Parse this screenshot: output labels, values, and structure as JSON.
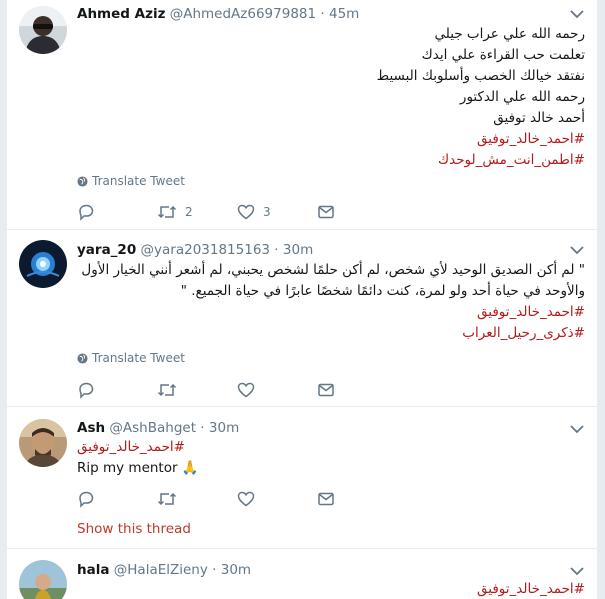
{
  "tweets": [
    {
      "name": "Ahmed Aziz",
      "handle": "@AhmedAz66979881",
      "time": "45m",
      "lines": [
        "رحمه الله علي عراب جيلي",
        "تعلمت حب القراءة علي ايدك",
        "نفتقد خيالك الخصب وأسلوبك البسيط",
        "رحمه الله علي الدكتور",
        "أحمد خالد توفيق"
      ],
      "hashtags": [
        "#احمد_خالد_توفيق",
        "#اطمن_انت_مش_لوحدك"
      ],
      "translate": "Translate Tweet",
      "reply_count": "",
      "retweet_count": "2",
      "like_count": "3"
    },
    {
      "name": "yara_20",
      "handle": "@yara2031815163",
      "time": "30m",
      "text": "\" لم أكن الصديق الوحيد لأي شخص، لم أكن حلمًا لشخص يحبني، لم أشعر أنني الخيار الأول والأوحد في حياة أحد ولو لمرة، كنت دائمًا شخصًا عابرًا في حياة الجميع. \"",
      "hashtags": [
        "#احمد_خالد_توفيق",
        "#ذكرى_رحيل_العراب"
      ],
      "translate": "Translate Tweet",
      "reply_count": "",
      "retweet_count": "",
      "like_count": ""
    },
    {
      "name": "Ash",
      "handle": "@AshBahget",
      "time": "30m",
      "hashtag": "#احمد_خالد_توفيق",
      "text": "Rip my mentor 🙏",
      "show_thread": "Show this thread"
    },
    {
      "name": "hala",
      "handle": "@HalaElZieny",
      "time": "30m",
      "hashtag": "#احمد_خالد_توفيق"
    }
  ],
  "separator": "·",
  "colors": {
    "hashtag": "#b31a1a",
    "muted": "#657786",
    "divider": "#e6ecf0",
    "thread_link": "#c0392b"
  },
  "icons": [
    "chevron-down-icon",
    "globe-icon",
    "reply-icon",
    "retweet-icon",
    "like-icon",
    "message-icon"
  ]
}
